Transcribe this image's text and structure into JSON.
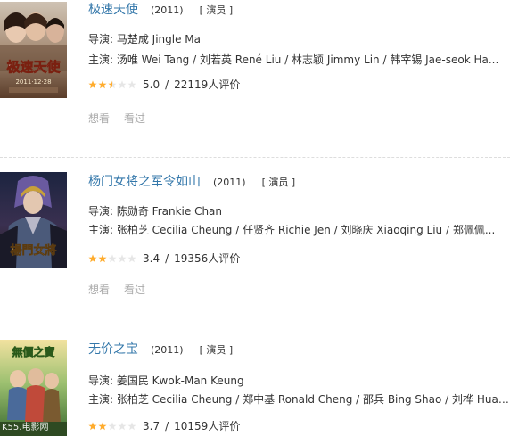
{
  "movies": [
    {
      "title": "极速天使",
      "year": "(2011)",
      "role": "[ 演员 ]",
      "director": "导演: 马楚成 Jingle Ma",
      "cast": "主演: 汤唯 Wei Tang / 刘若英 René Liu / 林志颖 Jimmy Lin / 韩宰锡 Jae-seok Ha...",
      "rating_fraction": 0.5,
      "score": "5.0",
      "sep": "/",
      "votes": "22119人评价",
      "want": "想看",
      "seen": "看过",
      "poster_text": "极速天使",
      "poster_date": "2011·12·28"
    },
    {
      "title": "杨门女将之军令如山",
      "year": "(2011)",
      "role": "[ 演员 ]",
      "director": "导演: 陈勋奇 Frankie Chan",
      "cast": "主演: 张柏芝 Cecilia Cheung / 任贤齐 Richie Jen / 刘晓庆 Xiaoqing Liu / 郑佩佩...",
      "rating_fraction": 0.4,
      "score": "3.4",
      "sep": "/",
      "votes": "19356人评价",
      "want": "想看",
      "seen": "看过",
      "poster_text": "楊門女將"
    },
    {
      "title": "无价之宝",
      "year": "(2011)",
      "role": "[ 演员 ]",
      "director": "导演: 姜国民 Kwok-Man Keung",
      "cast": "主演: 张柏芝 Cecilia Cheung / 郑中基 Ronald Cheng / 邵兵 Bing Shao / 刘桦 Hua ...",
      "rating_fraction": 0.4,
      "score": "3.7",
      "sep": "/",
      "votes": "10159人评价",
      "poster_text": "無價之寶"
    }
  ],
  "watermark": "K55.电影网",
  "colors": {
    "link": "#3377aa",
    "star_filled": "#ffac2d",
    "star_empty": "#e6e6e6",
    "muted": "#aaaaaa"
  }
}
